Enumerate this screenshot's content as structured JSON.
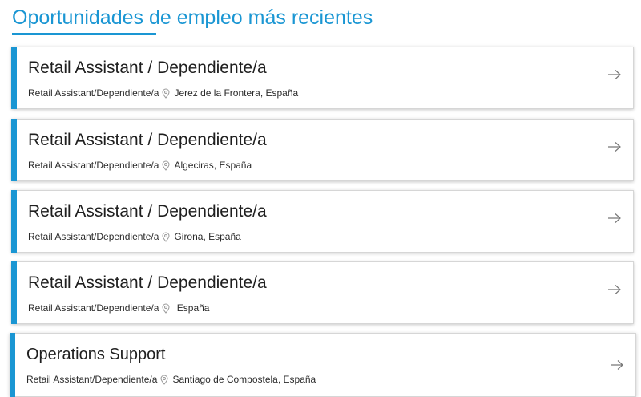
{
  "heading": {
    "title": "Oportunidades de empleo más recientes"
  },
  "jobs": [
    {
      "title": "Retail Assistant / Dependiente/a",
      "category": "Retail Assistant/Dependiente/a",
      "location": "Jerez de la Frontera, España"
    },
    {
      "title": "Retail Assistant / Dependiente/a",
      "category": "Retail Assistant/Dependiente/a",
      "location": "Algeciras, España"
    },
    {
      "title": "Retail Assistant / Dependiente/a",
      "category": "Retail Assistant/Dependiente/a",
      "location": "Girona, España"
    },
    {
      "title": "Retail Assistant / Dependiente/a",
      "category": "Retail Assistant/Dependiente/a",
      "location": " España"
    },
    {
      "title": "Operations Support",
      "category": "Retail Assistant/Dependiente/a",
      "location": "Santiago de Compostela, España"
    }
  ],
  "icons": {
    "location": "map-pin-icon",
    "open": "arrow-right-icon"
  },
  "colors": {
    "accent": "#1a96d3",
    "text": "#1f1f1f"
  }
}
